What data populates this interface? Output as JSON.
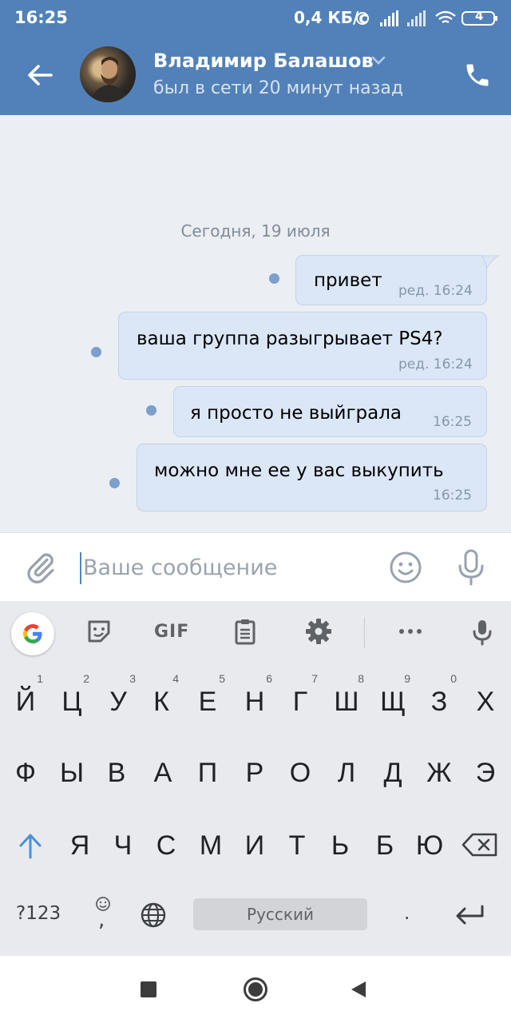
{
  "status_bar": {
    "time": "16:25",
    "network_speed": "0,4 КБ/с",
    "battery": "4"
  },
  "header": {
    "contact_name": "Владимир Балашов",
    "last_seen": "был в сети 20 минут назад"
  },
  "chat": {
    "date_separator": "Сегодня, 19 июля",
    "messages": [
      {
        "text": "привет",
        "time": "ред. 16:24"
      },
      {
        "text": "ваша группа разыгрывает PS4?",
        "time": "ред. 16:24"
      },
      {
        "text": "я просто не выйграла",
        "time": "16:25"
      },
      {
        "text": "можно мне ее у вас выкупить",
        "time": "16:25"
      }
    ]
  },
  "composer": {
    "placeholder": "Ваше сообщение"
  },
  "keyboard": {
    "toolbar": {
      "gif": "GIF"
    },
    "rows": [
      {
        "keys": [
          "Й",
          "Ц",
          "У",
          "К",
          "Е",
          "Н",
          "Г",
          "Ш",
          "Щ",
          "З",
          "Х"
        ],
        "hints": [
          "1",
          "2",
          "3",
          "4",
          "5",
          "6",
          "7",
          "8",
          "9",
          "0",
          ""
        ]
      },
      {
        "keys": [
          "Ф",
          "Ы",
          "В",
          "А",
          "П",
          "Р",
          "О",
          "Л",
          "Д",
          "Ж",
          "Э"
        ]
      },
      {
        "keys": [
          "Я",
          "Ч",
          "С",
          "М",
          "И",
          "Т",
          "Ь",
          "Б",
          "Ю"
        ]
      }
    ],
    "symbols_key": "?123",
    "comma_key": ",",
    "space_label": "Русский",
    "period_key": "."
  },
  "colors": {
    "header_bg": "#5181b8",
    "bubble_bg": "#dbe7f7",
    "chat_bg": "#ebeef3",
    "unread_dot": "#7c9fcb"
  },
  "icons": [
    "back-arrow-icon",
    "chevron-down-icon",
    "phone-icon",
    "paperclip-icon",
    "smile-icon",
    "microphone-icon",
    "google-icon",
    "sticker-icon",
    "clipboard-icon",
    "settings-icon",
    "more-icon",
    "shift-icon",
    "backspace-icon",
    "emoji-icon",
    "globe-icon",
    "enter-icon",
    "nav-recents-icon",
    "nav-home-icon",
    "nav-back-icon"
  ]
}
